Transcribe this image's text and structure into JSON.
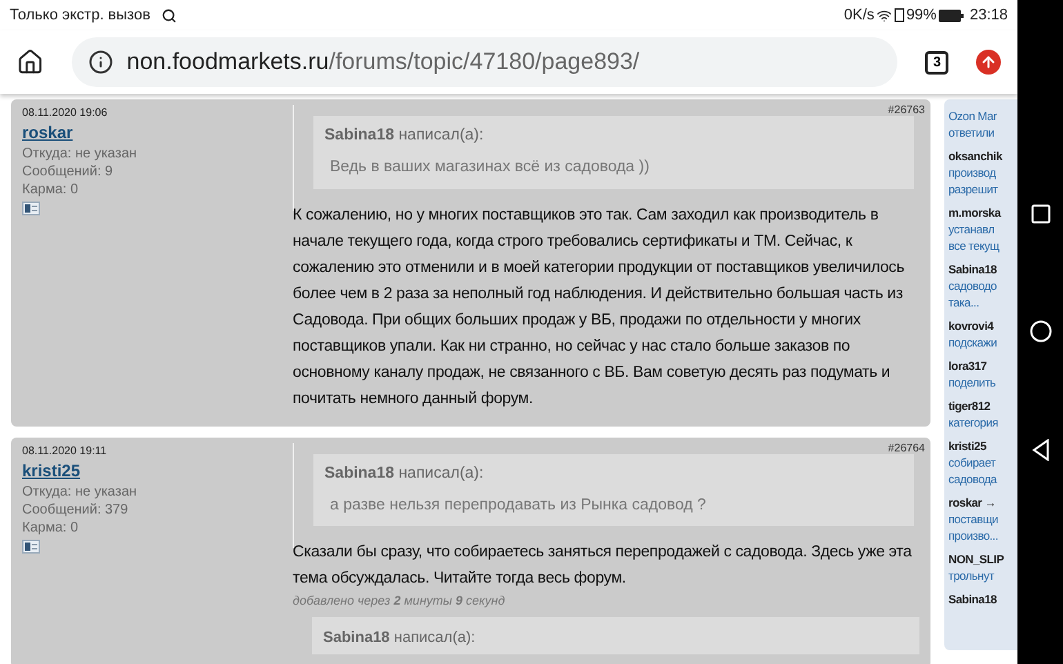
{
  "status_bar": {
    "carrier": "Только экстр. вызов",
    "speed": "0K/s",
    "battery": "99%",
    "time": "23:18"
  },
  "browser": {
    "url_host": "non.foodmarkets.ru",
    "url_path": "/forums/topic/47180/page893/",
    "tabs_count": "3"
  },
  "posts": [
    {
      "date": "08.11.2020 19:06",
      "number": "#26763",
      "author": "roskar",
      "from": "Откуда: не указан",
      "messages": "Сообщений: 9",
      "karma": "Карма: 0",
      "quote_author": "Sabina18",
      "quote_label": "написал(а):",
      "quote_text": "Ведь в ваших магазинах всё из садовода ))",
      "body": "К сожалению, но у многих поставщиков это так. Сам заходил как производитель в начале текущего года, когда строго требовались сертификаты и ТМ. Сейчас, к сожалению это отменили и в моей категории продукции от поставщиков увеличилось более чем в 2 раза за неполный год наблюдения. И действительно большая часть из Садовода. При общих больших продаж у ВБ, продажи по отдельности у многих поставщиков упали. Как ни странно, но сейчас у нас стало больше заказов по основному каналу продаж, не связанного с ВБ. Вам советую десять раз подумать и почитать немного данный форум."
    },
    {
      "date": "08.11.2020 19:11",
      "number": "#26764",
      "author": "kristi25",
      "from": "Откуда: не указан",
      "messages": "Сообщений: 379",
      "karma": "Карма: 0",
      "quote_author": "Sabina18",
      "quote_label": "написал(а):",
      "quote_text": "а разве нельзя перепродавать из Рынка садовод ?",
      "body": "Сказали бы сразу, что собираетесь заняться перепродажей с садовода. Здесь уже эта тема обсуждалась. Читайте тогда весь форум.",
      "added": "добавлено через **2** минуты **9** секунд",
      "next_quote_author": "Sabina18",
      "next_quote_label": "написал(а):"
    }
  ],
  "sidebar": [
    {
      "lines": [
        "Ozon Mar",
        "ответили"
      ]
    },
    {
      "name": "oksanchik",
      "lines": [
        "производ",
        "разрешит"
      ]
    },
    {
      "name": "m.morska",
      "lines": [
        "устанавл",
        "все текущ"
      ]
    },
    {
      "name": "Sabina18",
      "lines": [
        "садоводо",
        "така..."
      ]
    },
    {
      "name": "kovrovi4",
      "lines": [
        "подскажи"
      ]
    },
    {
      "name": "lora317",
      "lines": [
        "поделить"
      ]
    },
    {
      "name": "tiger812",
      "lines": [
        "категория"
      ]
    },
    {
      "name": "kristi25",
      "lines": [
        "собирает",
        "садовода"
      ]
    },
    {
      "name": "roskar →",
      "lines": [
        "поставщи",
        "произво..."
      ]
    },
    {
      "name": "NON_SLIP",
      "lines": [
        "трольнут"
      ]
    },
    {
      "name": "Sabina18"
    }
  ]
}
